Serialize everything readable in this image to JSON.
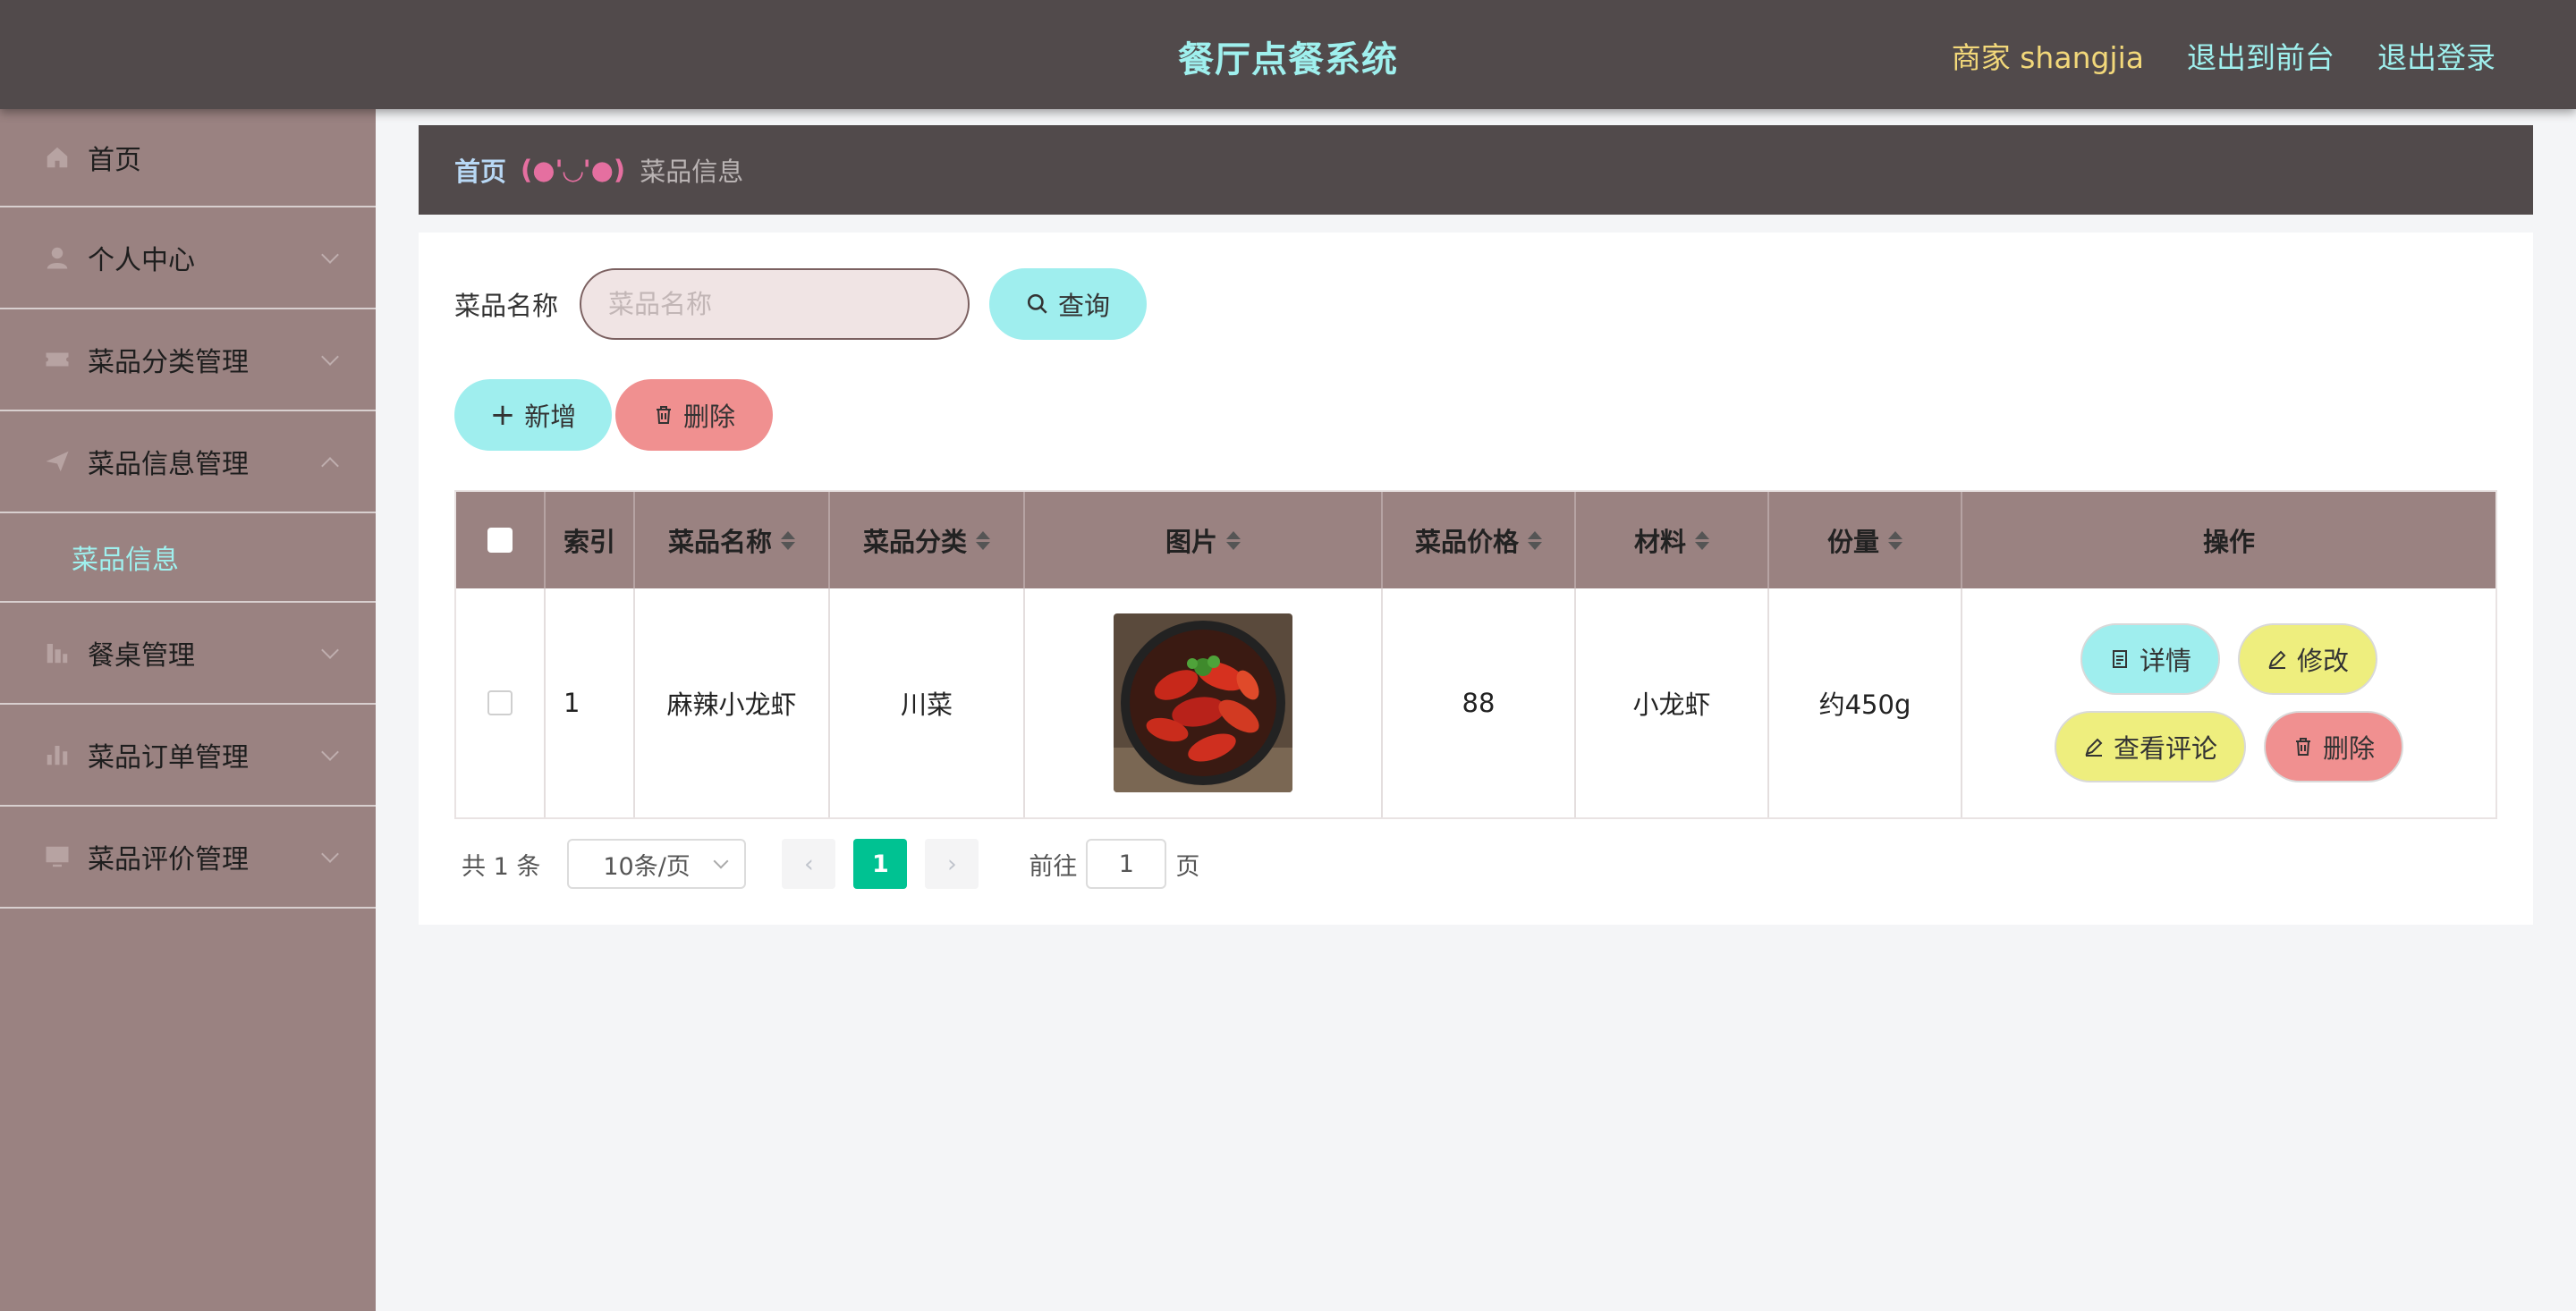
{
  "header": {
    "title": "餐厅点餐系统",
    "user_label": "商家 shangjia",
    "to_front_label": "退出到前台",
    "logout_label": "退出登录"
  },
  "sidebar": {
    "items": [
      {
        "label": "首页",
        "icon": "home-icon"
      },
      {
        "label": "个人中心",
        "icon": "user-icon"
      },
      {
        "label": "菜品分类管理",
        "icon": "ticket-icon"
      },
      {
        "label": "菜品信息管理",
        "icon": "send-icon"
      },
      {
        "label": "餐桌管理",
        "icon": "chart-icon"
      },
      {
        "label": "菜品订单管理",
        "icon": "bar-chart-icon"
      },
      {
        "label": "菜品评价管理",
        "icon": "monitor-icon"
      }
    ],
    "submenu_active": "菜品信息"
  },
  "breadcrumb": {
    "home": "首页",
    "separator": "(●'◡'●)",
    "current": "菜品信息"
  },
  "search": {
    "label": "菜品名称",
    "placeholder": "菜品名称",
    "query_label": "查询"
  },
  "actions": {
    "add_label": "新增",
    "delete_label": "删除"
  },
  "table": {
    "columns": [
      "索引",
      "菜品名称",
      "菜品分类",
      "图片",
      "菜品价格",
      "材料",
      "份量",
      "操作"
    ],
    "rows": [
      {
        "index": "1",
        "name": "麻辣小龙虾",
        "category": "川菜",
        "price": "88",
        "material": "小龙虾",
        "portion": "约450g"
      }
    ],
    "op_labels": {
      "detail": "详情",
      "edit": "修改",
      "review": "查看评论",
      "delete": "删除"
    }
  },
  "pagination": {
    "total": "共 1 条",
    "page_size": "10条/页",
    "current_page": "1",
    "goto_prefix": "前往",
    "goto_value": "1",
    "goto_suffix": "页"
  },
  "colors": {
    "header_bg": "#514a4b",
    "sidebar_bg": "#9a8281",
    "accent_cyan": "#9feeee",
    "accent_yellow": "#eeee7e",
    "accent_red": "#f09090",
    "page_active": "#00c292"
  }
}
